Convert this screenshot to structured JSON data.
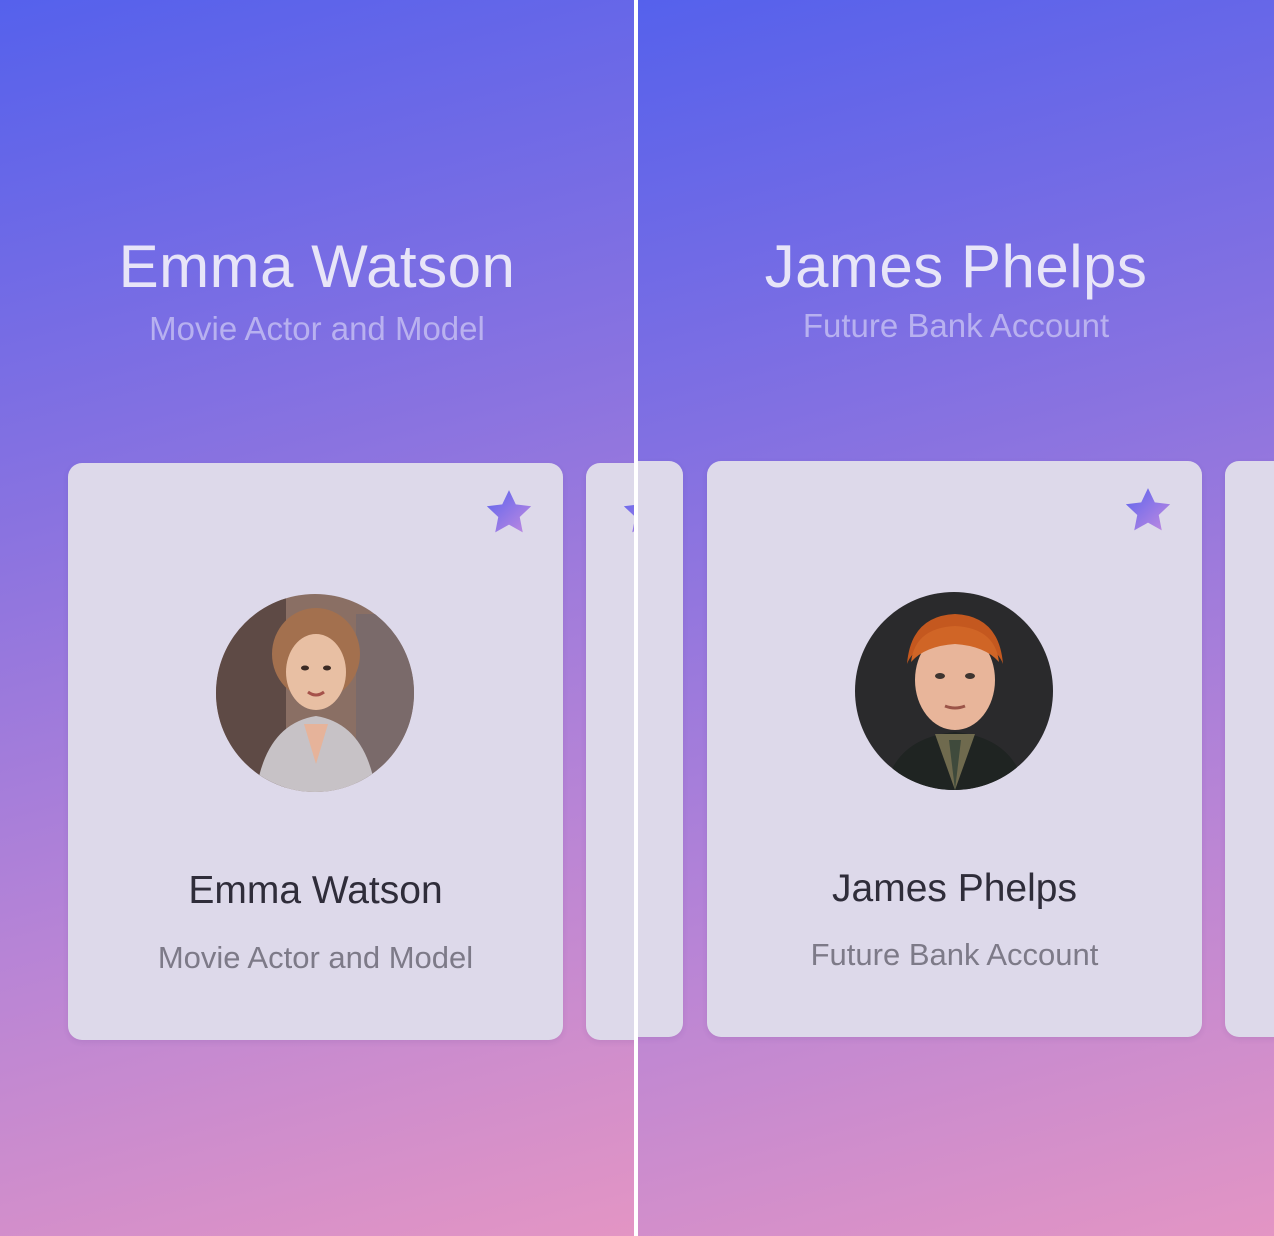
{
  "screens": [
    {
      "header": {
        "name": "Emma Watson",
        "subtitle": "Movie Actor and Model"
      },
      "card": {
        "name": "Emma Watson",
        "subtitle": "Movie Actor and Model",
        "favorite_icon": "star-icon",
        "avatar": "avatar-photo"
      }
    },
    {
      "header": {
        "name": "James Phelps",
        "subtitle": "Future Bank Account"
      },
      "card": {
        "name": "James Phelps",
        "subtitle": "Future Bank Account",
        "favorite_icon": "star-icon",
        "avatar": "avatar-photo"
      }
    }
  ],
  "colors": {
    "gradient_top": "#5561ec",
    "gradient_bottom": "#e395c4",
    "card_background": "#ddd9ea",
    "star_gradient": [
      "#5b63ee",
      "#c28be0"
    ]
  }
}
